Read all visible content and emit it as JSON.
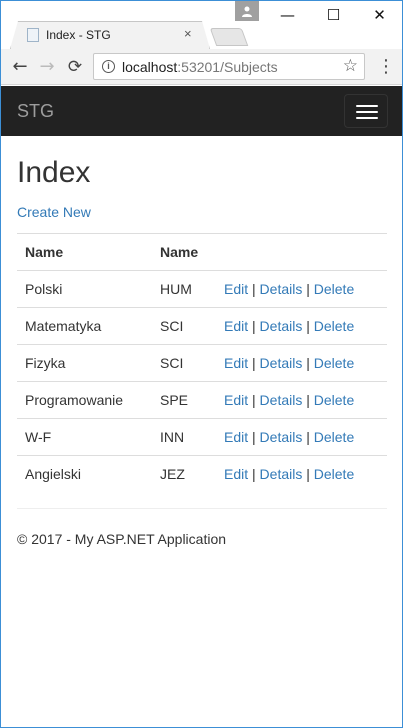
{
  "browser": {
    "tab_title": "Index - STG",
    "tab_close": "×",
    "profile_icon": "person-icon",
    "window_controls": {
      "minimize": "—",
      "maximize": "☐",
      "close": "✕"
    },
    "nav": {
      "back": "←",
      "forward": "→",
      "reload": "⟳",
      "menu": "⋮"
    },
    "url_host": "localhost",
    "url_rest": ":53201/Subjects",
    "info_glyph": "i",
    "star": "☆"
  },
  "navbar": {
    "brand": "STG"
  },
  "main": {
    "title": "Index",
    "create_new": "Create New",
    "table": {
      "headers": [
        "Name",
        "Name",
        ""
      ],
      "rows": [
        {
          "name": "Polski",
          "code": "HUM"
        },
        {
          "name": "Matematyka",
          "code": "SCI"
        },
        {
          "name": "Fizyka",
          "code": "SCI"
        },
        {
          "name": "Programowanie",
          "code": "SPE"
        },
        {
          "name": "W-F",
          "code": "INN"
        },
        {
          "name": "Angielski",
          "code": "JEZ"
        }
      ],
      "actions": {
        "edit": "Edit",
        "details": "Details",
        "delete": "Delete",
        "separator": "|"
      }
    }
  },
  "footer": {
    "text": "© 2017 - My ASP.NET Application"
  },
  "colors": {
    "navbar_bg": "#222222",
    "brand": "#9d9d9d",
    "link": "#337ab7",
    "window_border": "#3c8fd6"
  }
}
